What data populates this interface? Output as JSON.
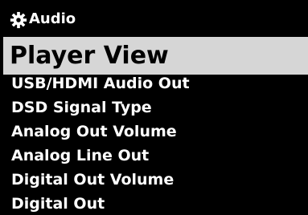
{
  "header": {
    "title": "Audio",
    "icon": "gear-icon"
  },
  "menu": {
    "selected_label": "Player View",
    "items": [
      "USB/HDMI Audio Out",
      "DSD Signal Type",
      "Analog Out Volume",
      "Analog Line Out",
      "Digital Out Volume",
      "Digital Out"
    ]
  },
  "colors": {
    "background": "#000000",
    "text": "#ffffff",
    "selection_bg": "#d6d6d6",
    "selection_text": "#000000"
  }
}
